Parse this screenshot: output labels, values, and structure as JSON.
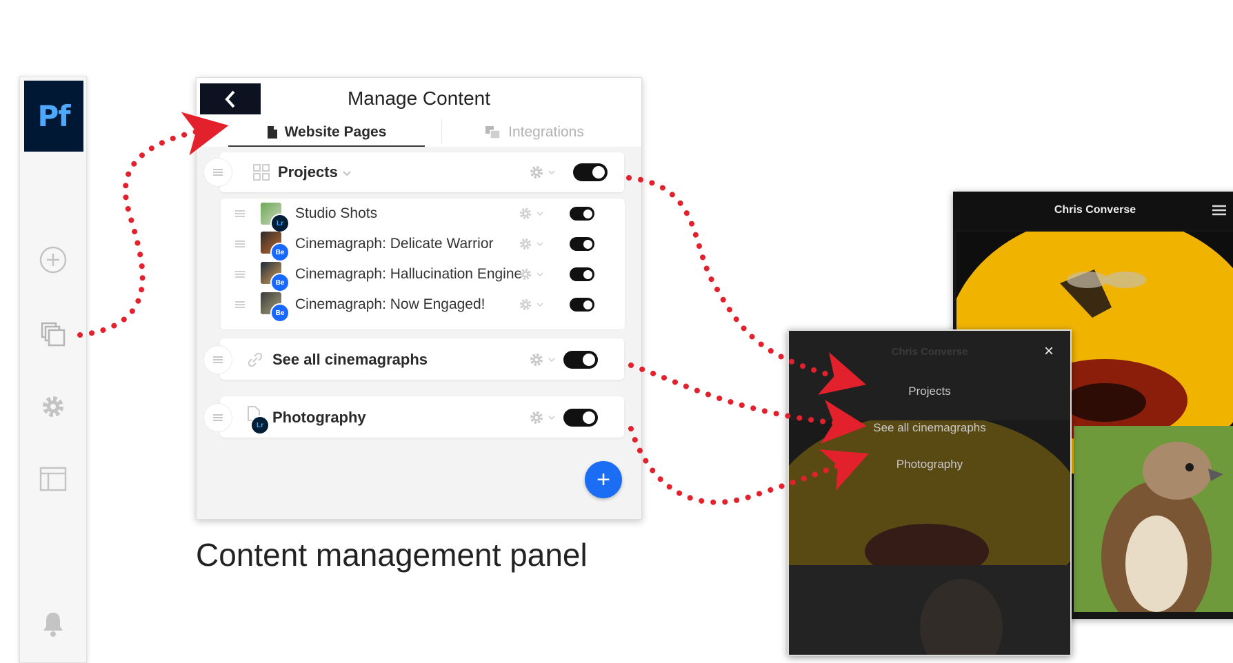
{
  "app": {
    "logo_text": "Pf"
  },
  "rail": {
    "icons": [
      "add-circle-icon",
      "pages-icon",
      "gear-icon",
      "layout-icon",
      "bell-icon"
    ]
  },
  "panel": {
    "title": "Manage Content",
    "tabs": [
      {
        "label": "Website Pages",
        "icon": "document-icon",
        "active": true
      },
      {
        "label": "Integrations",
        "icon": "integrations-icon",
        "active": false
      }
    ],
    "groups": [
      {
        "label": "Projects",
        "icon": "grid-icon",
        "toggle_on": true,
        "children": [
          {
            "label": "Studio Shots",
            "source": "Lr",
            "toggle_on": true
          },
          {
            "label": "Cinemagraph: Delicate Warrior",
            "source": "Be",
            "toggle_on": true
          },
          {
            "label": "Cinemagraph: Hallucination Engine",
            "source": "Be",
            "toggle_on": true
          },
          {
            "label": "Cinemagraph: Now Engaged!",
            "source": "Be",
            "toggle_on": true
          }
        ]
      },
      {
        "label": "See all cinemagraphs",
        "icon": "link-icon",
        "toggle_on": true
      },
      {
        "label": "Photography",
        "icon": "page-icon",
        "source": "Lr",
        "toggle_on": true
      }
    ],
    "fab_label": "+"
  },
  "caption": "Content management panel",
  "website_preview": {
    "site_title": "Chris Converse",
    "menu_title": "Chris Converse",
    "close_label": "×",
    "menu_items": [
      "Projects",
      "See all cinemagraphs",
      "Photography"
    ]
  },
  "colors": {
    "logo_bg": "#001834",
    "logo_text": "#4da8ff",
    "fab": "#1b6ef3",
    "connector": "#e3212d",
    "behance_badge": "#1769ff"
  }
}
